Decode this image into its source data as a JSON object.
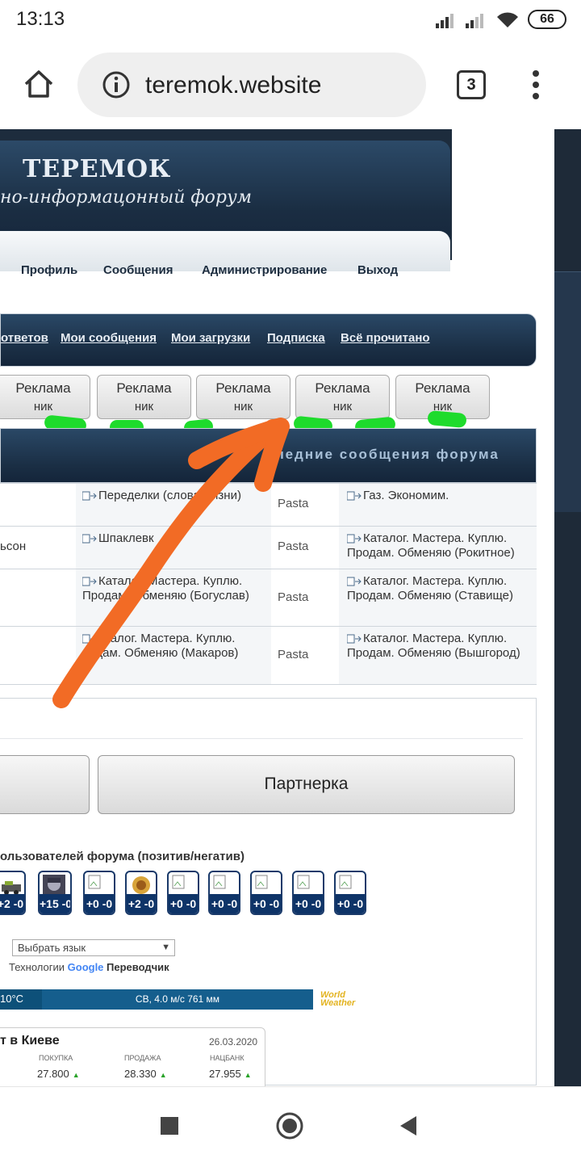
{
  "status_bar": {
    "time": "13:13",
    "battery": "66"
  },
  "browser": {
    "url": "teremok.website",
    "tab_count": "3"
  },
  "header": {
    "title": "ТЕРЕМОК",
    "subtitle": "но-информацонный форум"
  },
  "top_menu": [
    "Профиль",
    "Сообщения",
    "Администрирование",
    "Выход"
  ],
  "nav_links": [
    "ответов",
    "Мои сообщения",
    "Мои загрузки",
    "Подписка",
    "Всё прочитано"
  ],
  "ad_buttons": [
    {
      "line1": "Реклама",
      "line2": "ник"
    },
    {
      "line1": "Реклама",
      "line2": "ник"
    },
    {
      "line1": "Реклама",
      "line2": "ник"
    },
    {
      "line1": "Реклама",
      "line2": "ник"
    },
    {
      "line1": "Реклама",
      "line2": "ник"
    }
  ],
  "last_messages_title": "ледние сообщения форума",
  "messages": [
    {
      "c1": "",
      "topic": "Переделки (слова жизни)",
      "author": "Pasta",
      "last": "Газ. Экономим."
    },
    {
      "c1": "ьсон",
      "topic": "Шпаклевк",
      "author": "Pasta",
      "last": "Каталог. Мастера. Куплю. Продам. Обменяю (Рокитное)"
    },
    {
      "c1": "",
      "topic": "Каталог. Мастера. Куплю. Продам. Обменяю (Богуслав)",
      "author": "Pasta",
      "last": "Каталог. Мастера. Куплю. Продам. Обменяю (Ставище)"
    },
    {
      "c1": "",
      "topic": "аталог. Мастера. Куплю. родам. Обменяю (Макаров)",
      "author": "Pasta",
      "last": "Каталог. Мастера. Куплю. Продам. Обменяю (Вышгород)"
    }
  ],
  "partner_button": "Партнерка",
  "rating_title": "ользователей форума (позитив/негатив)",
  "avatars": [
    "+2 -0",
    "+15 -0",
    "+0 -0",
    "+2 -0",
    "+0 -0",
    "+0 -0",
    "+0 -0",
    "+0 -0",
    "+0 -0"
  ],
  "translate": {
    "select": "Выбрать язык",
    "powered_prefix": "Технологии",
    "google": "Google",
    "powered_suffix": "Переводчик"
  },
  "weather": {
    "temp": "10°C",
    "wind": "СВ, 4.0 м/с 761 мм",
    "logo_line1": "World",
    "logo_line2": "Weather"
  },
  "rates": {
    "title": "т в Киеве",
    "date": "26.03.2020",
    "labels": [
      "ПОКУПКА",
      "ПРОДАЖА",
      "НАЦБАНК"
    ],
    "values": [
      "27.800",
      "28.330",
      "27.955"
    ]
  },
  "annotation_colors": {
    "arrow": "#f26b25",
    "dashes": "#1edb2c"
  }
}
